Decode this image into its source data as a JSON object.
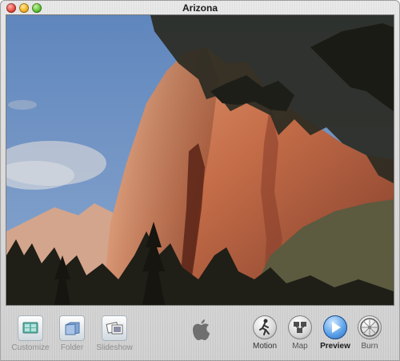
{
  "window": {
    "title": "Arizona"
  },
  "toolbar": {
    "left_items": [
      {
        "label": "Customize",
        "icon": "customize-icon"
      },
      {
        "label": "Folder",
        "icon": "folder-icon"
      },
      {
        "label": "Slideshow",
        "icon": "slideshow-icon"
      }
    ],
    "center_icon": "apple-logo-icon",
    "right_items": [
      {
        "label": "Motion",
        "icon": "motion-icon"
      },
      {
        "label": "Map",
        "icon": "map-icon"
      },
      {
        "label": "Preview",
        "icon": "preview-play-icon"
      },
      {
        "label": "Burn",
        "icon": "burn-icon"
      }
    ]
  },
  "colors": {
    "sky": "#6f93c1",
    "rock": "#c66e4b",
    "foliage": "#2c2a20",
    "preview_accent": "#2c68b8"
  }
}
